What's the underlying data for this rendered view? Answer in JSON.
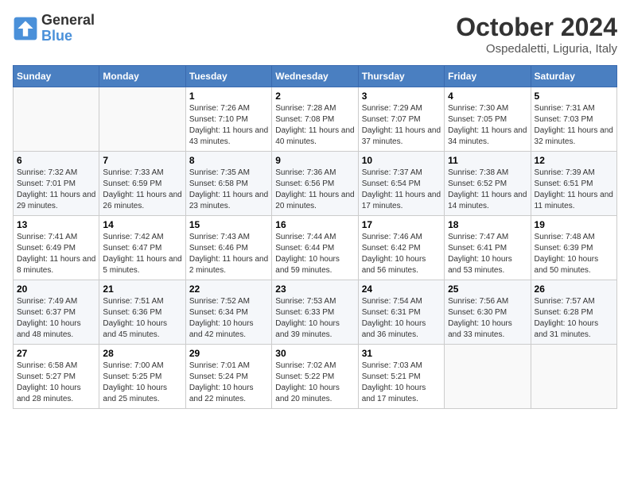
{
  "header": {
    "logo_general": "General",
    "logo_blue": "Blue",
    "month": "October 2024",
    "location": "Ospedaletti, Liguria, Italy"
  },
  "weekdays": [
    "Sunday",
    "Monday",
    "Tuesday",
    "Wednesday",
    "Thursday",
    "Friday",
    "Saturday"
  ],
  "weeks": [
    [
      {
        "day": "",
        "sunrise": "",
        "sunset": "",
        "daylight": ""
      },
      {
        "day": "",
        "sunrise": "",
        "sunset": "",
        "daylight": ""
      },
      {
        "day": "1",
        "sunrise": "Sunrise: 7:26 AM",
        "sunset": "Sunset: 7:10 PM",
        "daylight": "Daylight: 11 hours and 43 minutes."
      },
      {
        "day": "2",
        "sunrise": "Sunrise: 7:28 AM",
        "sunset": "Sunset: 7:08 PM",
        "daylight": "Daylight: 11 hours and 40 minutes."
      },
      {
        "day": "3",
        "sunrise": "Sunrise: 7:29 AM",
        "sunset": "Sunset: 7:07 PM",
        "daylight": "Daylight: 11 hours and 37 minutes."
      },
      {
        "day": "4",
        "sunrise": "Sunrise: 7:30 AM",
        "sunset": "Sunset: 7:05 PM",
        "daylight": "Daylight: 11 hours and 34 minutes."
      },
      {
        "day": "5",
        "sunrise": "Sunrise: 7:31 AM",
        "sunset": "Sunset: 7:03 PM",
        "daylight": "Daylight: 11 hours and 32 minutes."
      }
    ],
    [
      {
        "day": "6",
        "sunrise": "Sunrise: 7:32 AM",
        "sunset": "Sunset: 7:01 PM",
        "daylight": "Daylight: 11 hours and 29 minutes."
      },
      {
        "day": "7",
        "sunrise": "Sunrise: 7:33 AM",
        "sunset": "Sunset: 6:59 PM",
        "daylight": "Daylight: 11 hours and 26 minutes."
      },
      {
        "day": "8",
        "sunrise": "Sunrise: 7:35 AM",
        "sunset": "Sunset: 6:58 PM",
        "daylight": "Daylight: 11 hours and 23 minutes."
      },
      {
        "day": "9",
        "sunrise": "Sunrise: 7:36 AM",
        "sunset": "Sunset: 6:56 PM",
        "daylight": "Daylight: 11 hours and 20 minutes."
      },
      {
        "day": "10",
        "sunrise": "Sunrise: 7:37 AM",
        "sunset": "Sunset: 6:54 PM",
        "daylight": "Daylight: 11 hours and 17 minutes."
      },
      {
        "day": "11",
        "sunrise": "Sunrise: 7:38 AM",
        "sunset": "Sunset: 6:52 PM",
        "daylight": "Daylight: 11 hours and 14 minutes."
      },
      {
        "day": "12",
        "sunrise": "Sunrise: 7:39 AM",
        "sunset": "Sunset: 6:51 PM",
        "daylight": "Daylight: 11 hours and 11 minutes."
      }
    ],
    [
      {
        "day": "13",
        "sunrise": "Sunrise: 7:41 AM",
        "sunset": "Sunset: 6:49 PM",
        "daylight": "Daylight: 11 hours and 8 minutes."
      },
      {
        "day": "14",
        "sunrise": "Sunrise: 7:42 AM",
        "sunset": "Sunset: 6:47 PM",
        "daylight": "Daylight: 11 hours and 5 minutes."
      },
      {
        "day": "15",
        "sunrise": "Sunrise: 7:43 AM",
        "sunset": "Sunset: 6:46 PM",
        "daylight": "Daylight: 11 hours and 2 minutes."
      },
      {
        "day": "16",
        "sunrise": "Sunrise: 7:44 AM",
        "sunset": "Sunset: 6:44 PM",
        "daylight": "Daylight: 10 hours and 59 minutes."
      },
      {
        "day": "17",
        "sunrise": "Sunrise: 7:46 AM",
        "sunset": "Sunset: 6:42 PM",
        "daylight": "Daylight: 10 hours and 56 minutes."
      },
      {
        "day": "18",
        "sunrise": "Sunrise: 7:47 AM",
        "sunset": "Sunset: 6:41 PM",
        "daylight": "Daylight: 10 hours and 53 minutes."
      },
      {
        "day": "19",
        "sunrise": "Sunrise: 7:48 AM",
        "sunset": "Sunset: 6:39 PM",
        "daylight": "Daylight: 10 hours and 50 minutes."
      }
    ],
    [
      {
        "day": "20",
        "sunrise": "Sunrise: 7:49 AM",
        "sunset": "Sunset: 6:37 PM",
        "daylight": "Daylight: 10 hours and 48 minutes."
      },
      {
        "day": "21",
        "sunrise": "Sunrise: 7:51 AM",
        "sunset": "Sunset: 6:36 PM",
        "daylight": "Daylight: 10 hours and 45 minutes."
      },
      {
        "day": "22",
        "sunrise": "Sunrise: 7:52 AM",
        "sunset": "Sunset: 6:34 PM",
        "daylight": "Daylight: 10 hours and 42 minutes."
      },
      {
        "day": "23",
        "sunrise": "Sunrise: 7:53 AM",
        "sunset": "Sunset: 6:33 PM",
        "daylight": "Daylight: 10 hours and 39 minutes."
      },
      {
        "day": "24",
        "sunrise": "Sunrise: 7:54 AM",
        "sunset": "Sunset: 6:31 PM",
        "daylight": "Daylight: 10 hours and 36 minutes."
      },
      {
        "day": "25",
        "sunrise": "Sunrise: 7:56 AM",
        "sunset": "Sunset: 6:30 PM",
        "daylight": "Daylight: 10 hours and 33 minutes."
      },
      {
        "day": "26",
        "sunrise": "Sunrise: 7:57 AM",
        "sunset": "Sunset: 6:28 PM",
        "daylight": "Daylight: 10 hours and 31 minutes."
      }
    ],
    [
      {
        "day": "27",
        "sunrise": "Sunrise: 6:58 AM",
        "sunset": "Sunset: 5:27 PM",
        "daylight": "Daylight: 10 hours and 28 minutes."
      },
      {
        "day": "28",
        "sunrise": "Sunrise: 7:00 AM",
        "sunset": "Sunset: 5:25 PM",
        "daylight": "Daylight: 10 hours and 25 minutes."
      },
      {
        "day": "29",
        "sunrise": "Sunrise: 7:01 AM",
        "sunset": "Sunset: 5:24 PM",
        "daylight": "Daylight: 10 hours and 22 minutes."
      },
      {
        "day": "30",
        "sunrise": "Sunrise: 7:02 AM",
        "sunset": "Sunset: 5:22 PM",
        "daylight": "Daylight: 10 hours and 20 minutes."
      },
      {
        "day": "31",
        "sunrise": "Sunrise: 7:03 AM",
        "sunset": "Sunset: 5:21 PM",
        "daylight": "Daylight: 10 hours and 17 minutes."
      },
      {
        "day": "",
        "sunrise": "",
        "sunset": "",
        "daylight": ""
      },
      {
        "day": "",
        "sunrise": "",
        "sunset": "",
        "daylight": ""
      }
    ]
  ]
}
